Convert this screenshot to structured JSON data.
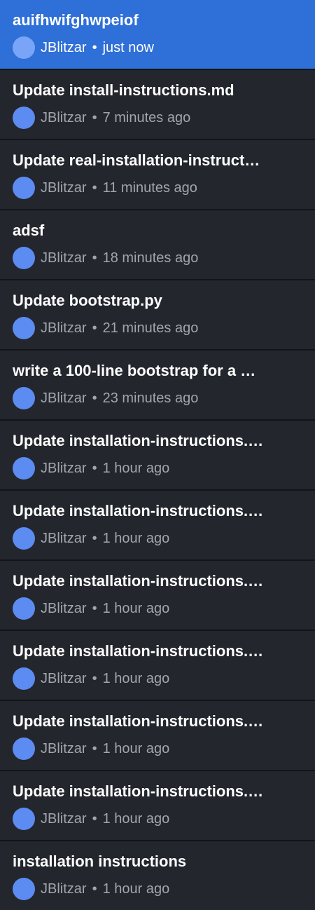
{
  "commits": [
    {
      "title": "auifhwifghwpeiof",
      "author": "JBlitzar",
      "separator": "•",
      "time": "just now"
    },
    {
      "title": "Update install-instructions.md",
      "author": "JBlitzar",
      "separator": "•",
      "time": "7 minutes ago"
    },
    {
      "title": "Update real-installation-instruct…",
      "author": "JBlitzar",
      "separator": "•",
      "time": "11 minutes ago"
    },
    {
      "title": "adsf",
      "author": "JBlitzar",
      "separator": "•",
      "time": "18 minutes ago"
    },
    {
      "title": "Update bootstrap.py",
      "author": "JBlitzar",
      "separator": "•",
      "time": "21 minutes ago"
    },
    {
      "title": "write a 100-line bootstrap for a …",
      "author": "JBlitzar",
      "separator": "•",
      "time": "23 minutes ago"
    },
    {
      "title": "Update installation-instructions.…",
      "author": "JBlitzar",
      "separator": "•",
      "time": "1 hour ago"
    },
    {
      "title": "Update installation-instructions.…",
      "author": "JBlitzar",
      "separator": "•",
      "time": "1 hour ago"
    },
    {
      "title": "Update installation-instructions.…",
      "author": "JBlitzar",
      "separator": "•",
      "time": "1 hour ago"
    },
    {
      "title": "Update installation-instructions.…",
      "author": "JBlitzar",
      "separator": "•",
      "time": "1 hour ago"
    },
    {
      "title": "Update installation-instructions.…",
      "author": "JBlitzar",
      "separator": "•",
      "time": "1 hour ago"
    },
    {
      "title": "Update installation-instructions.…",
      "author": "JBlitzar",
      "separator": "•",
      "time": "1 hour ago"
    },
    {
      "title": "installation instructions",
      "author": "JBlitzar",
      "separator": "•",
      "time": "1 hour ago"
    }
  ],
  "colors": {
    "background": "#23262c",
    "selected": "#2e6fd8",
    "divider": "#121417",
    "avatar": "#5c8bf2",
    "title": "#ffffff",
    "meta": "#a1a6ae"
  }
}
